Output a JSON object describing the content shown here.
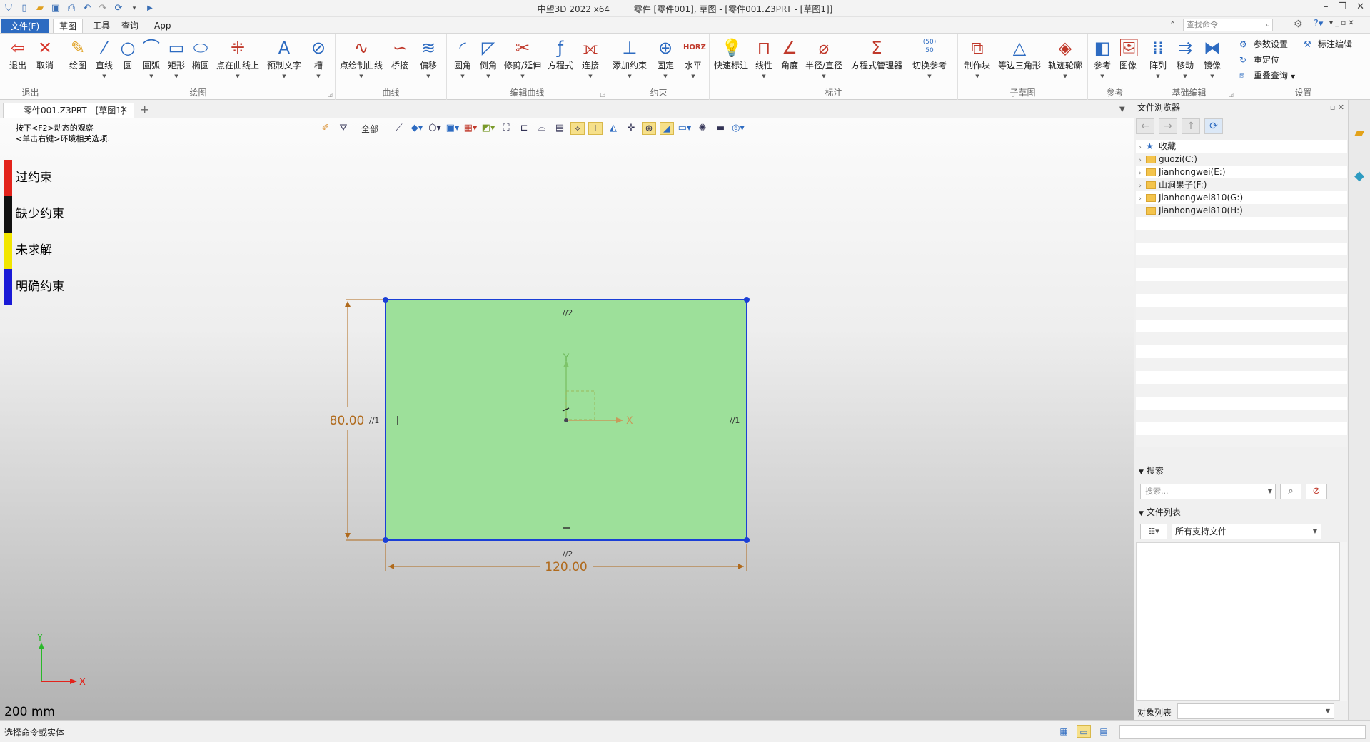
{
  "titlebar": {
    "app_name": "中望3D 2022 x64",
    "doc_title": "零件 [零件001], 草图 - [零件001.Z3PRT - [草图1]]"
  },
  "menu": {
    "file": "文件(F)",
    "tabs": [
      "草图",
      "工具",
      "查询",
      "App"
    ]
  },
  "search_command": {
    "placeholder": "查找命令"
  },
  "ribbon": {
    "groups": {
      "exit": "退出",
      "draw": "绘图",
      "curve": "曲线",
      "edit_curve": "编辑曲线",
      "constraint": "约束",
      "dimension": "标注",
      "subsketch": "子草图",
      "reference": "参考",
      "basic_edit": "基础编辑",
      "settings": "设置"
    },
    "buttons": {
      "exit": "退出",
      "cancel": "取消",
      "draw": "绘图",
      "line": "直线",
      "circle": "圆",
      "arc": "圆弧",
      "rect": "矩形",
      "ellipse": "椭圆",
      "point_on_curve": "点在曲线上",
      "preset_text": "预制文字",
      "slot": "槽",
      "point_curve": "点绘制曲线",
      "bridge": "桥接",
      "offset": "偏移",
      "fillet": "圆角",
      "chamfer": "倒角",
      "trim_extend": "修剪/延伸",
      "equation": "方程式",
      "connect": "连接",
      "add_constraint": "添加约束",
      "fix": "固定",
      "horizontal": "水平",
      "quick_dim": "快速标注",
      "linear": "线性",
      "angle": "角度",
      "radius_dia": "半径/直径",
      "equation_mgr": "方程式管理器",
      "toggle_ref": "切换参考",
      "make_block": "制作块",
      "isosceles": "等边三角形",
      "track_profile": "轨迹轮廓",
      "reference": "参考",
      "image": "图像",
      "array": "阵列",
      "move": "移动",
      "mirror": "镜像"
    },
    "small": {
      "param_settings": "参数设置",
      "reposition": "重定位",
      "overlap_query": "重叠查询",
      "dim_edit": "标注编辑"
    },
    "horz_badge": "HORZ",
    "toggle_badge": "(50)\n50"
  },
  "doc_tab": {
    "label": "零件001.Z3PRT - [草图1]"
  },
  "viewport": {
    "hints": [
      "按下<F2>动态的观察",
      "<单击右键>环境相关选项."
    ],
    "filter_label": "全部",
    "legend": [
      {
        "label": "过约束",
        "color": "#e3231b"
      },
      {
        "label": "缺少约束",
        "color": "#111111"
      },
      {
        "label": "未求解",
        "color": "#f2e600"
      },
      {
        "label": "明确约束",
        "color": "#1a1ad6"
      }
    ],
    "sketch": {
      "width_dim": "120.00",
      "height_dim": "80.00",
      "marks": {
        "top": "//2",
        "bottom": "//2",
        "left": "//1",
        "right": "//1"
      },
      "axis_x": "X",
      "axis_y": "Y",
      "fill_color": "#9de09a",
      "edge_color": "#1a3fd6",
      "dim_color": "#b06a1c"
    },
    "triad": {
      "x": "X",
      "y": "Y"
    },
    "scale_text": "200 mm"
  },
  "file_browser": {
    "title": "文件浏览器",
    "tree": [
      {
        "label": "收藏",
        "kind": "star"
      },
      {
        "label": "guozi(C:)",
        "kind": "folder"
      },
      {
        "label": "Jianhongwei(E:)",
        "kind": "folder"
      },
      {
        "label": "山涧果子(F:)",
        "kind": "folder"
      },
      {
        "label": "Jianhongwei810(G:)",
        "kind": "folder"
      },
      {
        "label": "Jianhongwei810(H:)",
        "kind": "folder"
      }
    ],
    "search_section": "搜索",
    "search_placeholder": "搜索...",
    "filelist_section": "文件列表",
    "file_type": "所有支持文件",
    "object_list_label": "对象列表"
  },
  "statusbar": {
    "text": "选择命令或实体"
  }
}
